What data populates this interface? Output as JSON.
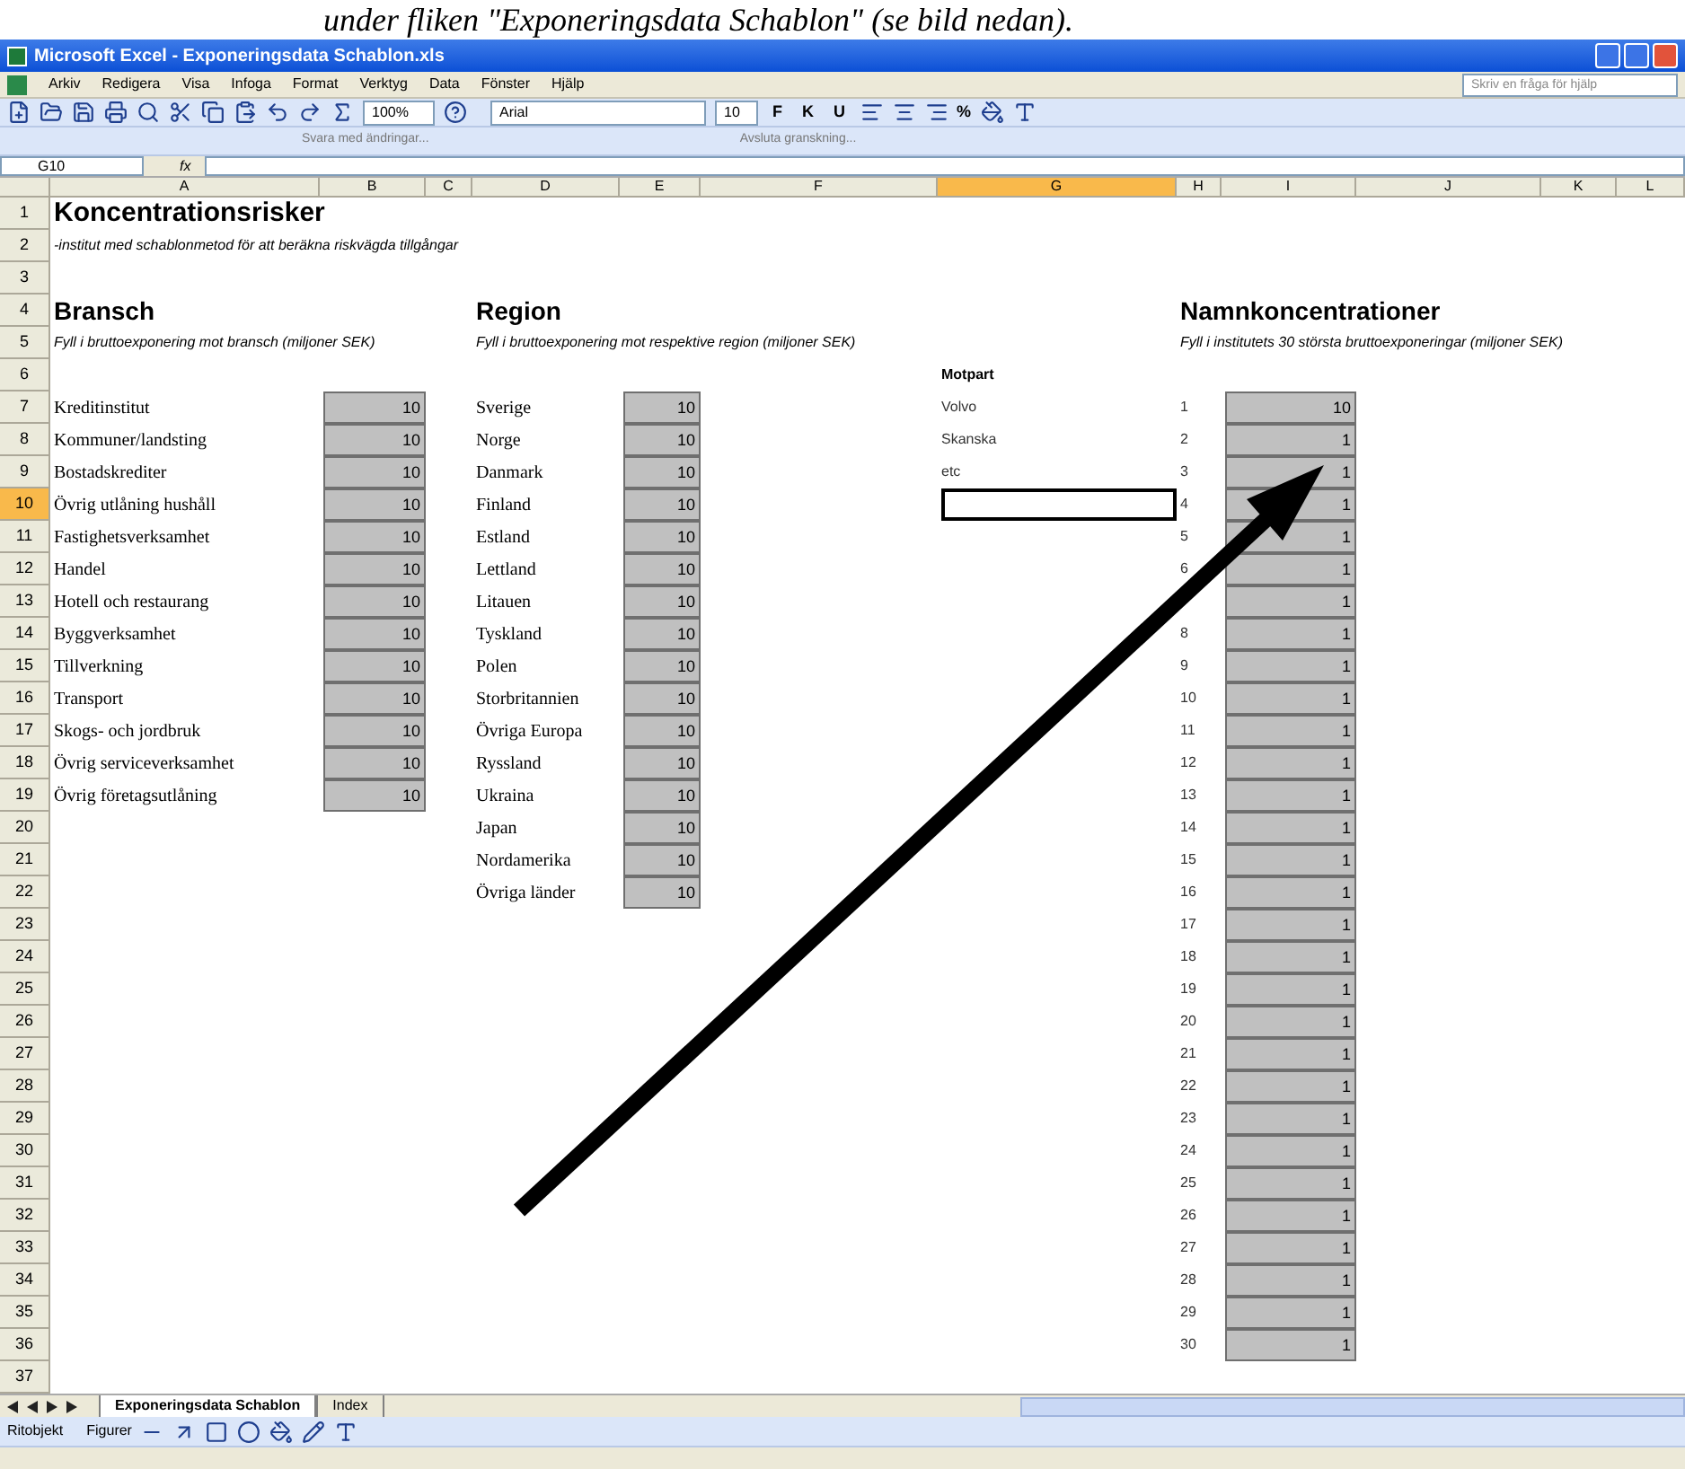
{
  "document_caption": "under fliken \"Exponeringsdata Schablon\" (se bild nedan).",
  "window": {
    "title": "Microsoft Excel - Exponeringsdata Schablon.xls"
  },
  "menu": [
    "Arkiv",
    "Redigera",
    "Visa",
    "Infoga",
    "Format",
    "Verktyg",
    "Data",
    "Fönster",
    "Hjälp"
  ],
  "help_search": {
    "placeholder": "Skriv en fråga för hjälp"
  },
  "toolbar": {
    "zoom": "100%",
    "font": "Arial",
    "font_size": "10",
    "format_buttons": [
      "F",
      "K",
      "U"
    ],
    "percent": "%"
  },
  "review_toolbar": [
    "Svara med ändringar...",
    "Avsluta granskning..."
  ],
  "formula_bar": {
    "name_box": "G10",
    "fx": "fx"
  },
  "columns": [
    {
      "label": "A",
      "selected": false
    },
    {
      "label": "B",
      "selected": false
    },
    {
      "label": "C",
      "selected": false
    },
    {
      "label": "D",
      "selected": false
    },
    {
      "label": "E",
      "selected": false
    },
    {
      "label": "F",
      "selected": false
    },
    {
      "label": "G",
      "selected": true
    },
    {
      "label": "H",
      "selected": false
    },
    {
      "label": "I",
      "selected": false
    },
    {
      "label": "J",
      "selected": false
    },
    {
      "label": "K",
      "selected": false
    },
    {
      "label": "L",
      "selected": false
    }
  ],
  "row_headers": [
    {
      "label": "1",
      "selected": false
    },
    {
      "label": "2",
      "selected": false
    },
    {
      "label": "3",
      "selected": false
    },
    {
      "label": "4",
      "selected": false
    },
    {
      "label": "5",
      "selected": false
    },
    {
      "label": "6",
      "selected": false
    },
    {
      "label": "7",
      "selected": false
    },
    {
      "label": "8",
      "selected": false
    },
    {
      "label": "9",
      "selected": false
    },
    {
      "label": "10",
      "selected": true
    },
    {
      "label": "11",
      "selected": false
    },
    {
      "label": "12",
      "selected": false
    },
    {
      "label": "13",
      "selected": false
    },
    {
      "label": "14",
      "selected": false
    },
    {
      "label": "15",
      "selected": false
    },
    {
      "label": "16",
      "selected": false
    },
    {
      "label": "17",
      "selected": false
    },
    {
      "label": "18",
      "selected": false
    },
    {
      "label": "19",
      "selected": false
    },
    {
      "label": "20",
      "selected": false
    },
    {
      "label": "21",
      "selected": false
    },
    {
      "label": "22",
      "selected": false
    },
    {
      "label": "23",
      "selected": false
    },
    {
      "label": "24",
      "selected": false
    },
    {
      "label": "25",
      "selected": false
    },
    {
      "label": "26",
      "selected": false
    },
    {
      "label": "27",
      "selected": false
    },
    {
      "label": "28",
      "selected": false
    },
    {
      "label": "29",
      "selected": false
    },
    {
      "label": "30",
      "selected": false
    },
    {
      "label": "31",
      "selected": false
    },
    {
      "label": "32",
      "selected": false
    },
    {
      "label": "33",
      "selected": false
    },
    {
      "label": "34",
      "selected": false
    },
    {
      "label": "35",
      "selected": false
    },
    {
      "label": "36",
      "selected": false
    },
    {
      "label": "37",
      "selected": false
    }
  ],
  "sheet_title": "Koncentrationsrisker",
  "sheet_subtitle": "-institut med schablonmetod för att beräkna riskvägda tillgångar",
  "bransch": {
    "heading": "Bransch",
    "note": "Fyll i bruttoexponering mot bransch (miljoner SEK)",
    "items": [
      {
        "label": "Kreditinstitut",
        "value": "10"
      },
      {
        "label": "Kommuner/landsting",
        "value": "10"
      },
      {
        "label": "Bostadskrediter",
        "value": "10"
      },
      {
        "label": "Övrig utlåning hushåll",
        "value": "10"
      },
      {
        "label": "Fastighetsverksamhet",
        "value": "10"
      },
      {
        "label": "Handel",
        "value": "10"
      },
      {
        "label": "Hotell och restaurang",
        "value": "10"
      },
      {
        "label": "Byggverksamhet",
        "value": "10"
      },
      {
        "label": "Tillverkning",
        "value": "10"
      },
      {
        "label": "Transport",
        "value": "10"
      },
      {
        "label": "Skogs- och jordbruk",
        "value": "10"
      },
      {
        "label": "Övrig serviceverksamhet",
        "value": "10"
      },
      {
        "label": "Övrig företagsutlåning",
        "value": "10"
      }
    ]
  },
  "region": {
    "heading": "Region",
    "note": "Fyll i bruttoexponering mot respektive region (miljoner SEK)",
    "items": [
      {
        "label": "Sverige",
        "value": "10"
      },
      {
        "label": "Norge",
        "value": "10"
      },
      {
        "label": "Danmark",
        "value": "10"
      },
      {
        "label": "Finland",
        "value": "10"
      },
      {
        "label": "Estland",
        "value": "10"
      },
      {
        "label": "Lettland",
        "value": "10"
      },
      {
        "label": "Litauen",
        "value": "10"
      },
      {
        "label": "Tyskland",
        "value": "10"
      },
      {
        "label": "Polen",
        "value": "10"
      },
      {
        "label": "Storbritannien",
        "value": "10"
      },
      {
        "label": "Övriga Europa",
        "value": "10"
      },
      {
        "label": "Ryssland",
        "value": "10"
      },
      {
        "label": "Ukraina",
        "value": "10"
      },
      {
        "label": "Japan",
        "value": "10"
      },
      {
        "label": "Nordamerika",
        "value": "10"
      },
      {
        "label": "Övriga länder",
        "value": "10"
      }
    ]
  },
  "namn": {
    "heading": "Namnkoncentrationer",
    "note": "Fyll i institutets 30 största bruttoexponeringar (miljoner SEK)",
    "counterparty_header": "Motpart",
    "counterparties": [
      "Volvo",
      "Skanska",
      "etc"
    ],
    "items": [
      {
        "number": "1",
        "value": "10"
      },
      {
        "number": "2",
        "value": "1"
      },
      {
        "number": "3",
        "value": "1"
      },
      {
        "number": "4",
        "value": "1"
      },
      {
        "number": "5",
        "value": "1"
      },
      {
        "number": "6",
        "value": "1"
      },
      {
        "value": "1"
      },
      {
        "number": "8",
        "value": "1"
      },
      {
        "number": "9",
        "value": "1"
      },
      {
        "number": "10",
        "value": "1"
      },
      {
        "number": "11",
        "value": "1"
      },
      {
        "number": "12",
        "value": "1"
      },
      {
        "number": "13",
        "value": "1"
      },
      {
        "number": "14",
        "value": "1"
      },
      {
        "number": "15",
        "value": "1"
      },
      {
        "number": "16",
        "value": "1"
      },
      {
        "number": "17",
        "value": "1"
      },
      {
        "number": "18",
        "value": "1"
      },
      {
        "number": "19",
        "value": "1"
      },
      {
        "number": "20",
        "value": "1"
      },
      {
        "number": "21",
        "value": "1"
      },
      {
        "number": "22",
        "value": "1"
      },
      {
        "number": "23",
        "value": "1"
      },
      {
        "number": "24",
        "value": "1"
      },
      {
        "number": "25",
        "value": "1"
      },
      {
        "number": "26",
        "value": "1"
      },
      {
        "number": "27",
        "value": "1"
      },
      {
        "number": "28",
        "value": "1"
      },
      {
        "number": "29",
        "value": "1"
      },
      {
        "number": "30",
        "value": "1"
      }
    ]
  },
  "sheet_tabs": [
    {
      "label": "Exponeringsdata Schablon",
      "selected": true
    },
    {
      "label": "Index",
      "selected": false
    }
  ],
  "drawing_toolbar": {
    "draw": "Ritobjekt",
    "shapes": "Figurer"
  }
}
